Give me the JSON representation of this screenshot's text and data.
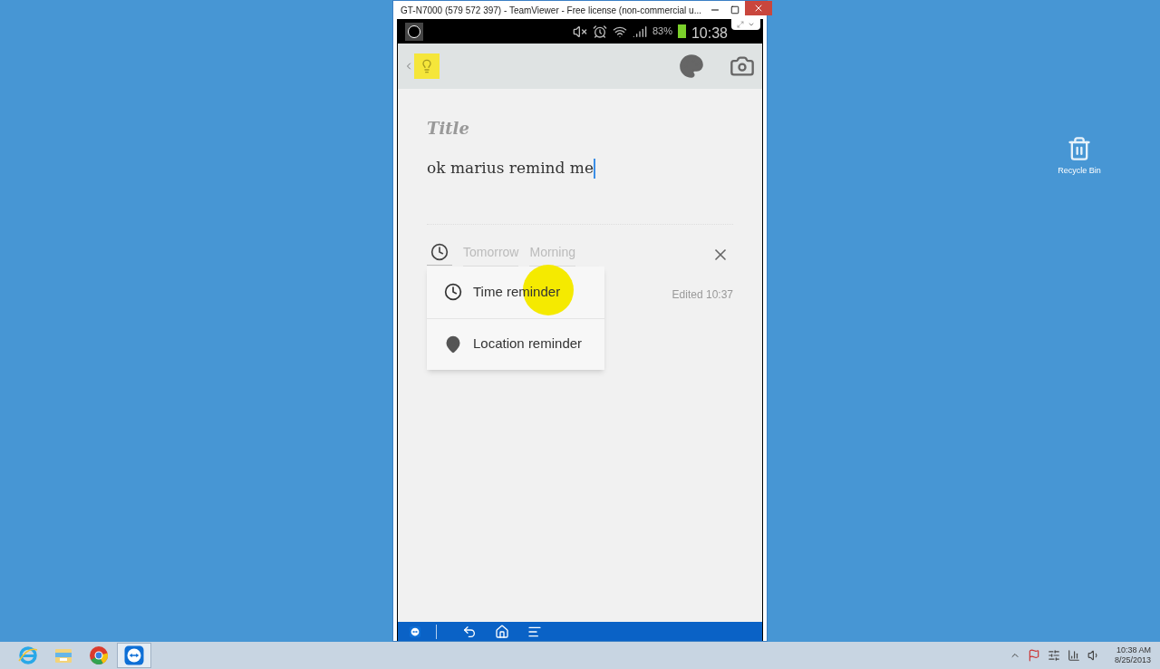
{
  "window": {
    "title": "GT-N7000 (579 572 397) - TeamViewer - Free license (non-commercial u..."
  },
  "status_bar": {
    "battery": "83%",
    "time": "10:38"
  },
  "note": {
    "title_placeholder": "Title",
    "body": "ok marius remind me",
    "reminder_chips": [
      {
        "label": "Tomorrow"
      },
      {
        "label": "Morning"
      }
    ],
    "edited": "Edited 10:37"
  },
  "reminder_menu": [
    {
      "kind": "time",
      "label": "Time reminder"
    },
    {
      "kind": "location",
      "label": "Location reminder"
    }
  ],
  "desktop_icons": [
    {
      "label": "Recycle Bin"
    }
  ],
  "taskbar": {
    "apps": [
      {
        "kind": "ie",
        "selected": false
      },
      {
        "kind": "explorer",
        "selected": false
      },
      {
        "kind": "chrome",
        "selected": false
      },
      {
        "kind": "teamviewer",
        "selected": true
      }
    ],
    "clock": {
      "time": "10:38 AM",
      "date": "8/25/2013"
    }
  }
}
